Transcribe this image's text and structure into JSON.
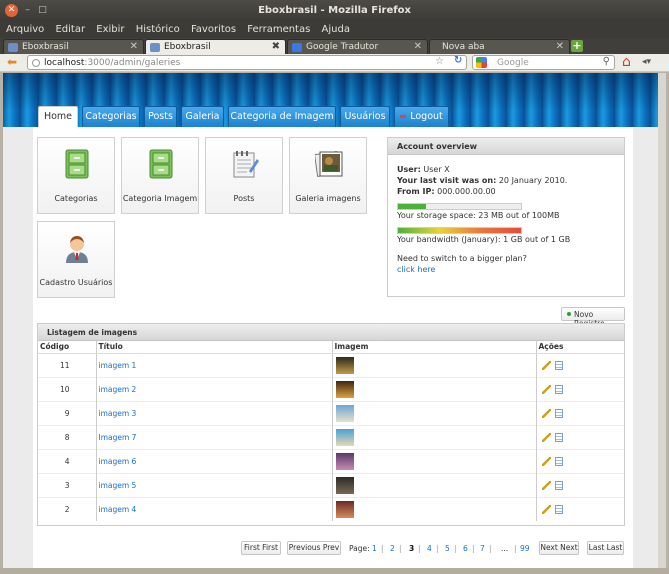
{
  "window": {
    "title": "Eboxbrasil - Mozilla Firefox"
  },
  "menu": [
    "Arquivo",
    "Editar",
    "Exibir",
    "Histórico",
    "Favoritos",
    "Ferramentas",
    "Ajuda"
  ],
  "tabs": [
    {
      "label": "Eboxbrasil",
      "active": false,
      "icon_color": "#6b8fc7"
    },
    {
      "label": "Eboxbrasil",
      "active": true,
      "icon_color": "#6b8fc7"
    },
    {
      "label": "Google Tradutor",
      "active": false,
      "icon_color": "#3b78e7"
    },
    {
      "label": "Nova aba",
      "active": false,
      "icon_color": "#57564f"
    }
  ],
  "url": {
    "host": "localhost",
    "path": ":3000/admin/galeries"
  },
  "search": {
    "placeholder": "Google"
  },
  "nav": [
    "Home",
    "Categorias",
    "Posts",
    "Galeria",
    "Categoria de Imagem",
    "Usuários",
    "Logout"
  ],
  "tiles": [
    {
      "label": "Categorias",
      "icon": "cabinet-icon"
    },
    {
      "label": "Categoria Imagem",
      "icon": "cabinet-icon"
    },
    {
      "label": "Posts",
      "icon": "notepad-icon"
    },
    {
      "label": "Galeria imagens",
      "icon": "photos-icon"
    },
    {
      "label": "Cadastro Usuários",
      "icon": "user-icon"
    }
  ],
  "account": {
    "title": "Account overview",
    "user_label": "User:",
    "user": "User X",
    "visit_label": "Your last visit was on:",
    "visit": "20 January 2010.",
    "ip_label": "From IP:",
    "ip": "000.000.00.00",
    "storage_text": "Your storage space: 23 MB out of 100MB",
    "storage_pct": 23,
    "bandwidth_text": "Your bandwidth (January): 1 GB out of 1 GB",
    "bandwidth_pct": 100,
    "upgrade_text": "Need to switch to a bigger plan?",
    "upgrade_link": "click here"
  },
  "new_button": "Novo Registro",
  "list": {
    "title": "Listagem de imagens",
    "headers": [
      "Código",
      "Título",
      "Imagem",
      "Ações"
    ],
    "rows": [
      {
        "code": "11",
        "title": "imagem 1",
        "thumb": [
          "#2a2a1a",
          "#c49a4a"
        ]
      },
      {
        "code": "10",
        "title": "imagem 2",
        "thumb": [
          "#3a2a12",
          "#e0a040"
        ]
      },
      {
        "code": "9",
        "title": "imagem 3",
        "thumb": [
          "#6aa7d8",
          "#e8e0c8"
        ]
      },
      {
        "code": "8",
        "title": "Imagem 7",
        "thumb": [
          "#4aa0d8",
          "#e6d9b0"
        ]
      },
      {
        "code": "4",
        "title": "imagem 6",
        "thumb": [
          "#5a3a6a",
          "#c88ab0"
        ]
      },
      {
        "code": "3",
        "title": "imagem 5",
        "thumb": [
          "#2b2a26",
          "#7a6a55"
        ]
      },
      {
        "code": "2",
        "title": "imagem 4",
        "thumb": [
          "#6a2a2a",
          "#d88a5a"
        ]
      }
    ]
  },
  "pager": {
    "first": "First First",
    "prev": "Previous Prev",
    "page_label": "Page:",
    "pages": [
      "1",
      "2",
      "3",
      "4",
      "5",
      "6",
      "7",
      "...",
      "99"
    ],
    "current": "3",
    "next": "Next Next",
    "last": "Last Last"
  }
}
